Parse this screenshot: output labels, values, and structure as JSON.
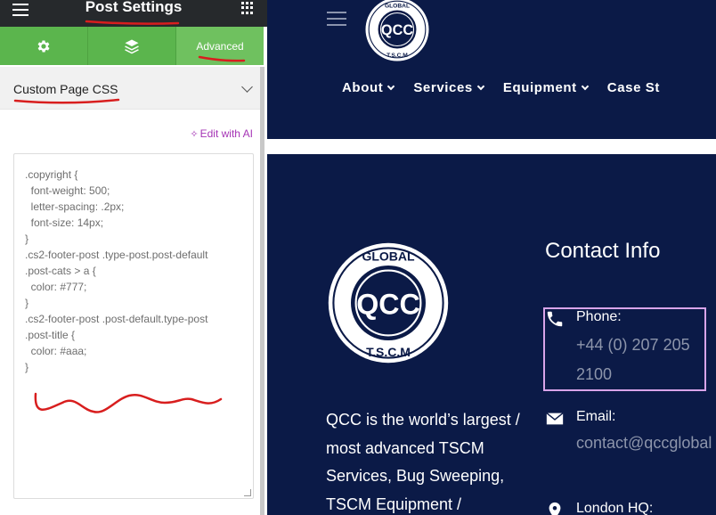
{
  "panel": {
    "title": "Post Settings",
    "tabs": [
      {
        "name": "settings",
        "icon": "gear-icon",
        "label": ""
      },
      {
        "name": "style",
        "icon": "layers-icon",
        "label": ""
      },
      {
        "name": "advanced",
        "icon": "",
        "label": "Advanced"
      }
    ],
    "section_title": "Custom Page CSS",
    "ai_link": "Edit with AI",
    "css_lines": [
      ".copyright {",
      "  font-weight: 500;",
      "  letter-spacing: .2px;",
      "  font-size: 14px;",
      "}",
      ".cs2-footer-post .type-post.post-default",
      ".post-cats > a {",
      "  color: #777;",
      "}",
      ".cs2-footer-post .post-default.type-post",
      ".post-title {",
      "  color: #aaa;",
      "}"
    ]
  },
  "site": {
    "logo": {
      "top": "GLOBAL",
      "center": "QCC",
      "bottom": "T.S.C.M"
    },
    "nav": [
      "About",
      "Services",
      "Equipment",
      "Case St"
    ],
    "footer": {
      "description": "QCC is the world’s largest / most advanced TSCM Services, Bug Sweeping, TSCM Equipment /",
      "contact_title": "Contact Info",
      "phone_label": "Phone:",
      "phone_value_line1": "+44 (0) 207 205",
      "phone_value_line2": "2100",
      "email_label": "Email:",
      "email_value": "contact@qccglobal",
      "address_label": "London HQ:"
    }
  },
  "colors": {
    "editor_dark": "#26292c",
    "tab_green": "#5bb54d",
    "site_navy": "#0b1a47",
    "annotation_red": "#d81e1e",
    "highlight_pink": "#d8a4e9",
    "ai_purple": "#a534b5"
  }
}
